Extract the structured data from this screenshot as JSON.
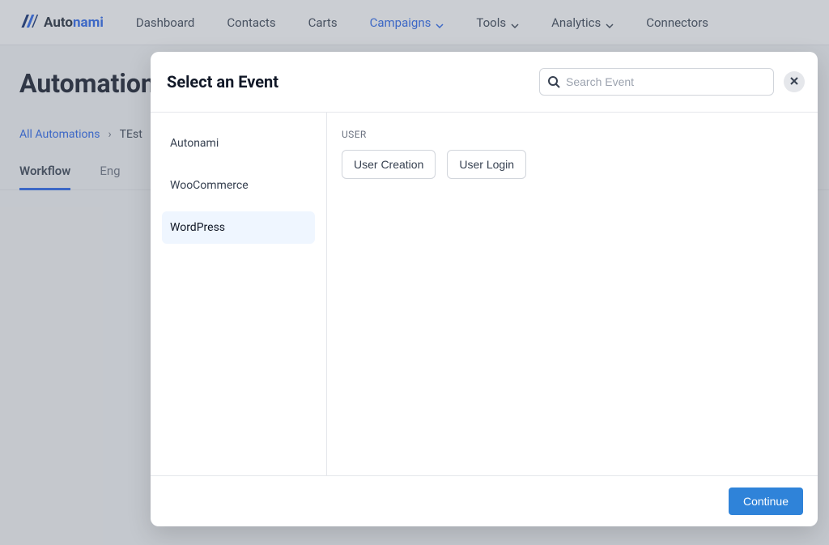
{
  "brand": {
    "name_auto": "Auto",
    "name_nami": "nami"
  },
  "nav": {
    "dashboard": "Dashboard",
    "contacts": "Contacts",
    "carts": "Carts",
    "campaigns": "Campaigns",
    "tools": "Tools",
    "analytics": "Analytics",
    "connectors": "Connectors"
  },
  "page": {
    "title": "Automations",
    "breadcrumb_all": "All Automations",
    "breadcrumb_current": "TEst"
  },
  "tabs": {
    "workflow": "Workflow",
    "eng": "Eng"
  },
  "modal": {
    "title": "Select an Event",
    "search_placeholder": "Search Event",
    "sidebar": {
      "autonami": "Autonami",
      "woocommerce": "WooCommerce",
      "wordpress": "WordPress"
    },
    "content": {
      "group": "USER",
      "events": [
        "User Creation",
        "User Login"
      ]
    },
    "continue": "Continue"
  }
}
